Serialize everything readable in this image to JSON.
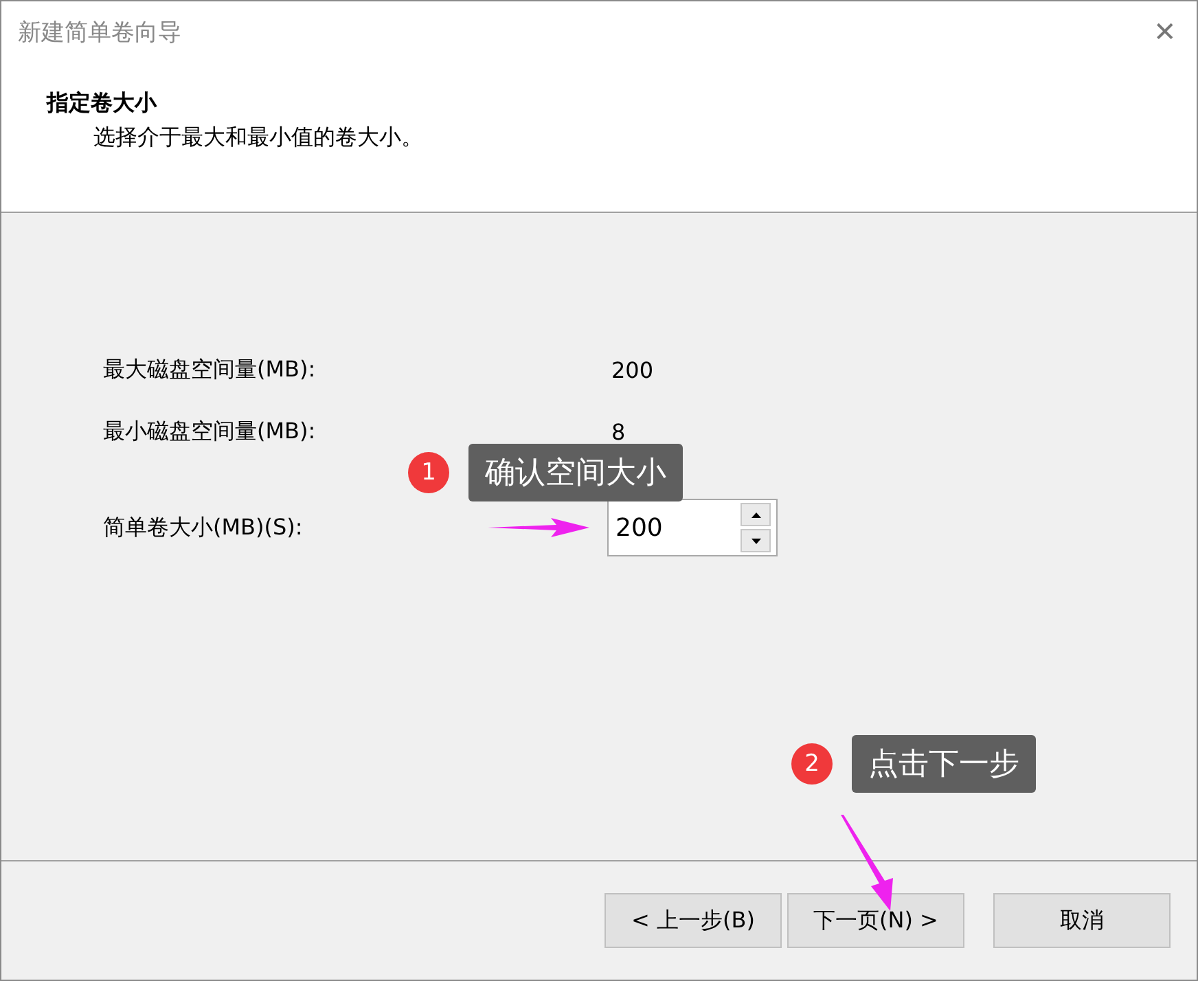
{
  "window": {
    "title": "新建简单卷向导",
    "close": "✕"
  },
  "header": {
    "title": "指定卷大小",
    "subtitle": "选择介于最大和最小值的卷大小。"
  },
  "fields": [
    {
      "kind": "value",
      "label": "最大磁盘空间量(MB):",
      "value": "200"
    },
    {
      "kind": "value",
      "label": "最小磁盘空间量(MB):",
      "value": "8"
    },
    {
      "kind": "spinner",
      "label": "简单卷大小(MB)(S):",
      "value": "200"
    }
  ],
  "buttons": [
    {
      "label": "< 上一步(B)"
    },
    {
      "label": "下一页(N) >"
    },
    {
      "label": "取消"
    }
  ],
  "annotations": [
    {
      "number": "1",
      "text": "确认空间大小"
    },
    {
      "number": "2",
      "text": "点击下一步"
    }
  ]
}
